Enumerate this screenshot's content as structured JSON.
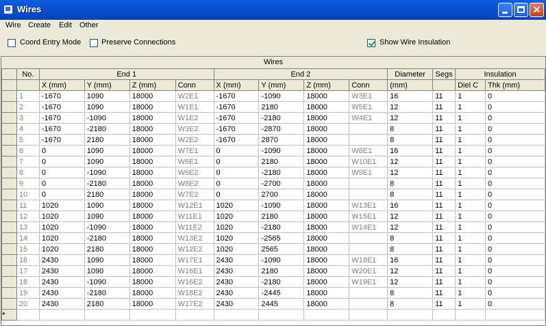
{
  "window": {
    "title": "Wires",
    "icon": "window-app-icon",
    "controls": [
      "minimize",
      "maximize",
      "close"
    ]
  },
  "menu": [
    "Wire",
    "Create",
    "Edit",
    "Other"
  ],
  "options": {
    "coord_entry_mode": {
      "label": "Coord Entry Mode",
      "checked": false
    },
    "preserve_connections": {
      "label": "Preserve Connections",
      "checked": false
    },
    "show_wire_insulation": {
      "label": "Show Wire Insulation",
      "checked": true
    }
  },
  "grid": {
    "caption": "Wires",
    "group_headers": {
      "no": "No.",
      "end1": "End 1",
      "end2": "End 2",
      "diameter": "Diameter",
      "segs": "Segs",
      "insulation": "Insulation"
    },
    "columns": [
      "X (mm)",
      "Y (mm)",
      "Z (mm)",
      "Conn",
      "X (mm)",
      "Y (mm)",
      "Z (mm)",
      "Conn",
      "(mm)",
      "",
      "Diel C",
      "Thk (mm)"
    ],
    "new_row_marker": "*",
    "rows": [
      [
        "1",
        "-1670",
        "1090",
        "18000",
        "W2E1",
        "-1670",
        "-1090",
        "18000",
        "W3E1",
        "16",
        "11",
        "1",
        "0"
      ],
      [
        "2",
        "-1670",
        "1090",
        "18000",
        "W1E1",
        "-1670",
        "2180",
        "18000",
        "W5E1",
        "12",
        "11",
        "1",
        "0"
      ],
      [
        "3",
        "-1670",
        "-1090",
        "18000",
        "W1E2",
        "-1670",
        "-2180",
        "18000",
        "W4E1",
        "12",
        "11",
        "1",
        "0"
      ],
      [
        "4",
        "-1670",
        "-2180",
        "18000",
        "W3E2",
        "-1670",
        "-2870",
        "18000",
        "",
        "8",
        "11",
        "1",
        "0"
      ],
      [
        "5",
        "-1670",
        "2180",
        "18000",
        "W2E2",
        "-1670",
        "2870",
        "18000",
        "",
        "8",
        "11",
        "1",
        "0"
      ],
      [
        "6",
        "0",
        "1090",
        "18000",
        "W7E1",
        "0",
        "-1090",
        "18000",
        "W8E1",
        "16",
        "11",
        "1",
        "0"
      ],
      [
        "7",
        "0",
        "1090",
        "18000",
        "W6E1",
        "0",
        "2180",
        "18000",
        "W10E1",
        "12",
        "11",
        "1",
        "0"
      ],
      [
        "8",
        "0",
        "-1090",
        "18000",
        "W6E2",
        "0",
        "-2180",
        "18000",
        "W9E1",
        "12",
        "11",
        "1",
        "0"
      ],
      [
        "9",
        "0",
        "-2180",
        "18000",
        "W8E2",
        "0",
        "-2700",
        "18000",
        "",
        "8",
        "11",
        "1",
        "0"
      ],
      [
        "10",
        "0",
        "2180",
        "18000",
        "W7E2",
        "0",
        "2700",
        "18000",
        "",
        "8",
        "11",
        "1",
        "0"
      ],
      [
        "11",
        "1020",
        "1090",
        "18000",
        "W12E1",
        "1020",
        "-1090",
        "18000",
        "W13E1",
        "16",
        "11",
        "1",
        "0"
      ],
      [
        "12",
        "1020",
        "1090",
        "18000",
        "W11E1",
        "1020",
        "2180",
        "18000",
        "W15E1",
        "12",
        "11",
        "1",
        "0"
      ],
      [
        "13",
        "1020",
        "-1090",
        "18000",
        "W11E2",
        "1020",
        "-2180",
        "18000",
        "W14E1",
        "12",
        "11",
        "1",
        "0"
      ],
      [
        "14",
        "1020",
        "-2180",
        "18000",
        "W13E2",
        "1020",
        "-2565",
        "18000",
        "",
        "8",
        "11",
        "1",
        "0"
      ],
      [
        "15",
        "1020",
        "2180",
        "18000",
        "W12E2",
        "1020",
        "2565",
        "18000",
        "",
        "8",
        "11",
        "1",
        "0"
      ],
      [
        "16",
        "2430",
        "1090",
        "18000",
        "W17E1",
        "2430",
        "-1090",
        "18000",
        "W18E1",
        "16",
        "11",
        "1",
        "0"
      ],
      [
        "17",
        "2430",
        "1090",
        "18000",
        "W16E1",
        "2430",
        "2180",
        "18000",
        "W20E1",
        "12",
        "11",
        "1",
        "0"
      ],
      [
        "18",
        "2430",
        "-1090",
        "18000",
        "W16E2",
        "2430",
        "-2180",
        "18000",
        "W19E1",
        "12",
        "11",
        "1",
        "0"
      ],
      [
        "19",
        "2430",
        "-2180",
        "18000",
        "W18E2",
        "2430",
        "-2445",
        "18000",
        "",
        "8",
        "11",
        "1",
        "0"
      ],
      [
        "20",
        "2430",
        "2180",
        "18000",
        "W17E2",
        "2430",
        "2445",
        "18000",
        "",
        "8",
        "11",
        "1",
        "0"
      ]
    ]
  }
}
